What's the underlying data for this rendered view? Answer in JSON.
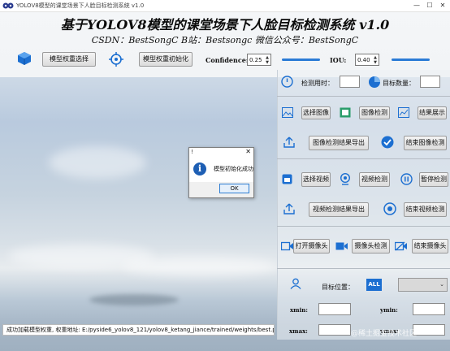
{
  "window": {
    "title": "YOLOV8模型的课堂场景下人脸目标检测系统 v1.0",
    "minimize": "—",
    "maximize": "☐",
    "close": "✕"
  },
  "header": {
    "title": "基于YOLOV8模型的课堂场景下人脸目标检测系统 v1.0",
    "subtitle": "CSDN：BestSongC   B站：Bestsongc   微信公众号：BestSongC"
  },
  "toolbar": {
    "select_weights_label": "模型权重选择",
    "init_weights_label": "模型权重初始化",
    "confidence_label": "Confidence:",
    "confidence_value": "0.25",
    "iou_label": "IOU:",
    "iou_value": "0.40"
  },
  "stats": {
    "time_label": "检测用时：",
    "count_label": "目标数量："
  },
  "image_section": {
    "select_label": "选择图像",
    "detect_label": "图像检测",
    "show_label": "结果展示",
    "export_label": "图像检测结果导出",
    "stop_label": "结束图像检测"
  },
  "video_section": {
    "select_label": "选择视频",
    "detect_label": "视频检测",
    "pause_label": "暂停检测",
    "export_label": "视频检测结果导出",
    "stop_label": "结束视频检测"
  },
  "camera_section": {
    "open_label": "打开摄像头",
    "detect_label": "摄像头检测",
    "stop_label": "结束摄像头"
  },
  "target": {
    "position_label": "目标位置：",
    "all_badge": "ALL",
    "xmin_label": "xmin:",
    "ymin_label": "ymin:",
    "xmax_label": "xmax:",
    "ymax_label": "ymax:"
  },
  "status_bar": {
    "text": "成功加载模型权重, 权重地址: E:/pyside6_yolov8_121/yolov8_ketang_jiance/trained/weights/best.pt"
  },
  "dialog": {
    "title": "!",
    "message": "模型初始化成功",
    "ok_label": "OK"
  },
  "watermark": "@稀土掘金技术社区",
  "colors": {
    "accent_blue": "#2b7bd6",
    "info_blue": "#1e5fb4"
  }
}
